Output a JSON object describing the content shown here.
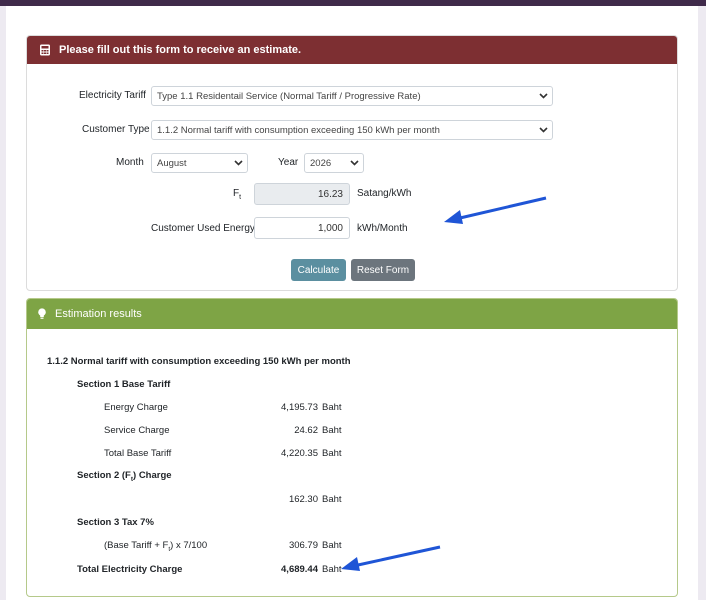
{
  "form": {
    "header": "Please fill out this form to receive an estimate.",
    "tariff_label": "Electricity Tariff",
    "tariff_value": "Type 1.1 Residentail Service (Normal Tariff / Progressive Rate)",
    "customer_type_label": "Customer Type",
    "customer_type_value": "1.1.2 Normal tariff with consumption exceeding 150 kWh per month",
    "month_label": "Month",
    "month_value": "August",
    "year_label": "Year",
    "year_value": "2026",
    "ft_label": "F",
    "ft_sub": "t",
    "ft_value": "16.23",
    "ft_unit": "Satang/kWh",
    "energy_label": "Customer Used Energy",
    "energy_value": "1,000",
    "energy_unit": "kWh/Month",
    "calculate_label": "Calculate",
    "reset_label": "Reset Form"
  },
  "results": {
    "header": "Estimation results",
    "title": "1.1.2 Normal tariff with consumption exceeding 150 kWh per month",
    "section1": "Section 1 Base Tariff",
    "energy_charge_label": "Energy Charge",
    "energy_charge_value": "4,195.73",
    "service_charge_label": "Service Charge",
    "service_charge_value": "24.62",
    "total_base_label": "Total Base Tariff",
    "total_base_value": "4,220.35",
    "section2_pre": "Section 2 (F",
    "section2_sub": "t",
    "section2_post": ") Charge",
    "ft_charge_value": "162.30",
    "section3": "Section 3 Tax 7%",
    "tax_pre": "(Base Tariff + F",
    "tax_sub": "t",
    "tax_post": ") x 7/100",
    "tax_value": "306.79",
    "total_label": "Total Electricity Charge",
    "total_value": "4,689.44",
    "currency": "Baht"
  },
  "colors": {
    "form_header": "#7d2f32",
    "results_header": "#7ea445",
    "calculate_button": "#5b8fa0",
    "reset_button": "#6c757d",
    "annotation_arrow": "#1f55d6"
  },
  "icons": {
    "form_header_icon": "calculator-icon",
    "results_header_icon": "lightbulb-icon",
    "select_chevron": "chevron-down-icon"
  }
}
